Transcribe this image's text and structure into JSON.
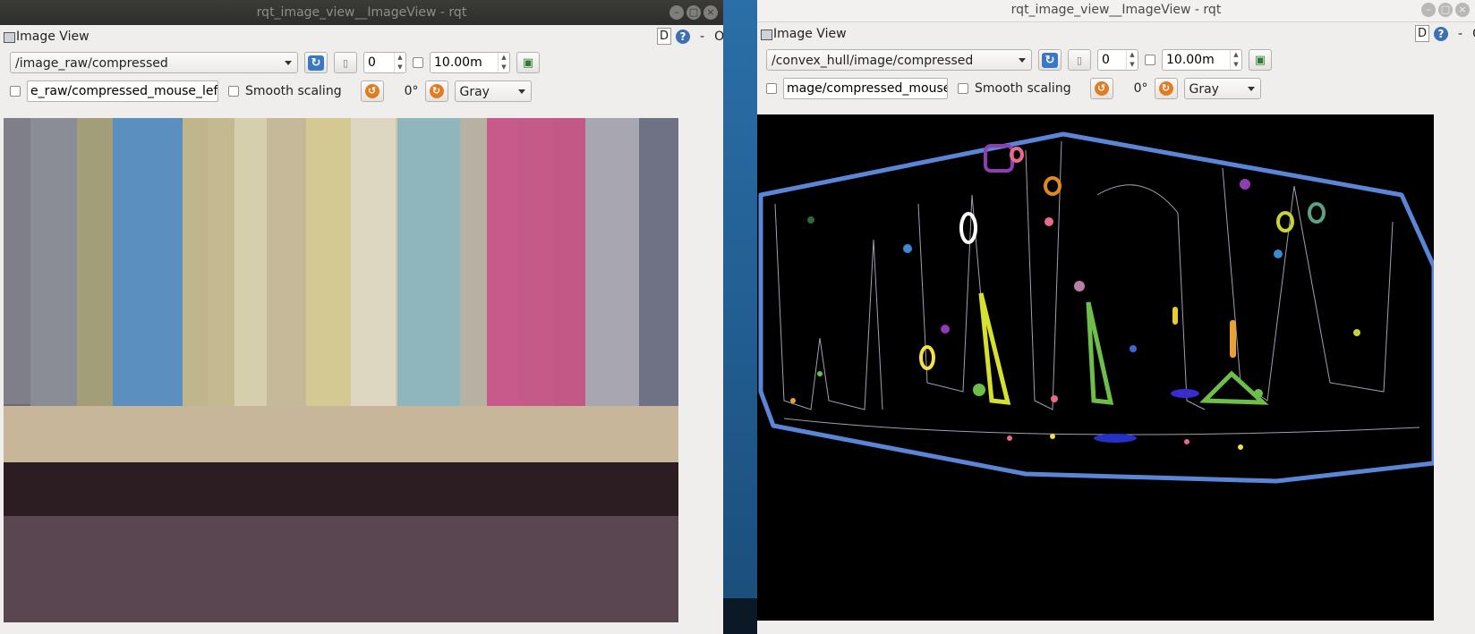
{
  "windows": [
    {
      "title": "rqt_image_view__ImageView - rqt",
      "dock_title": "Image View",
      "dock_right": {
        "d": "D",
        "help": "?",
        "minus": "-",
        "o": "O"
      },
      "topic": "/image_raw/compressed",
      "num_value": "0",
      "max_range": "10.00m",
      "mouse_topic": "e_raw/compressed_mouse_left",
      "smooth_label": "Smooth scaling",
      "rotation": "0°",
      "color_scheme": "Gray"
    },
    {
      "title": "rqt_image_view__ImageView - rqt",
      "dock_title": "Image View",
      "dock_right": {
        "d": "D",
        "help": "?",
        "minus": "-",
        "o": "O"
      },
      "topic": "/convex_hull/image/compressed",
      "num_value": "0",
      "max_range": "10.00m",
      "mouse_topic": "mage/compressed_mouse_left",
      "smooth_label": "Smooth scaling",
      "rotation": "0°",
      "color_scheme": "Gray"
    }
  ],
  "icons": {
    "refresh": "refresh-icon",
    "pause": "pause-icon",
    "save": "save-image-icon",
    "rotate_left": "rotate-left-icon",
    "rotate_right": "rotate-right-icon",
    "dock": "dock-widget-icon"
  }
}
